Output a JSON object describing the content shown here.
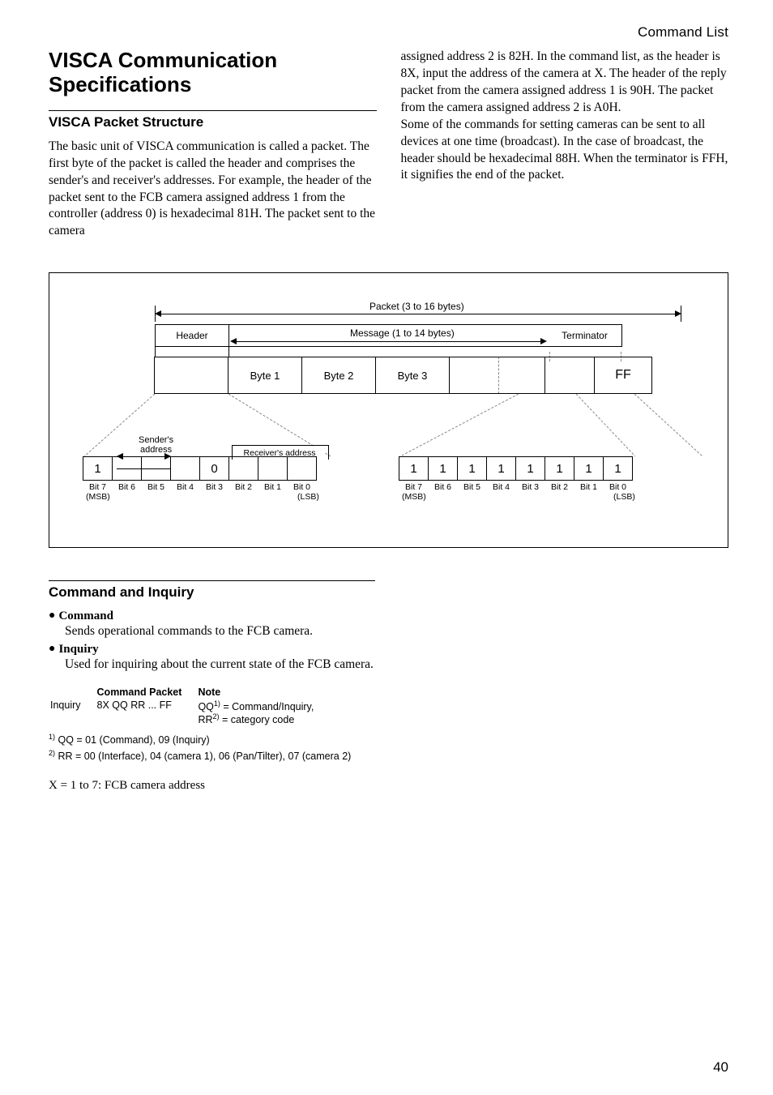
{
  "running_head": "Command List",
  "title": "VISCA Communication Specifications",
  "section1_heading": "VISCA Packet Structure",
  "left_para": "The basic unit of VISCA communication is called a packet. The first byte of the packet is called the header and comprises the sender's and receiver's addresses. For example, the header of the packet sent to the FCB camera assigned address 1 from the controller (address 0) is hexadecimal 81H. The packet sent to the camera",
  "right_para": "assigned address 2 is 82H. In the command list, as the header is 8X, input the address of the camera at X. The header of the reply packet from the camera assigned address 1 is 90H. The packet from the camera assigned address 2 is A0H.\nSome of the commands for setting cameras can be sent to all devices at one time (broadcast). In the case of broadcast, the header should be hexadecimal 88H. When the terminator is FFH, it signifies the end of the packet.",
  "diagram": {
    "packet_label": "Packet (3 to 16 bytes)",
    "header_label": "Header",
    "message_label": "Message (1 to 14 bytes)",
    "terminator_label": "Terminator",
    "byte1": "Byte 1",
    "byte2": "Byte 2",
    "byte3": "Byte 3",
    "ff": "FF",
    "senders_address": "Sender's\naddress",
    "receivers_address": "Receiver's address",
    "bit7": "Bit 7",
    "bit6": "Bit 6",
    "bit5": "Bit 5",
    "bit4": "Bit 4",
    "bit3": "Bit 3",
    "bit2": "Bit 2",
    "bit1": "Bit 1",
    "bit0": "Bit 0",
    "msb": "(MSB)",
    "lsb": "(LSB)",
    "one": "1",
    "zero": "0"
  },
  "section2_heading": "Command and Inquiry",
  "bullets": {
    "cmd_label": "Command",
    "cmd_desc": "Sends operational commands to the FCB camera.",
    "inq_label": "Inquiry",
    "inq_desc": "Used for inquiring about the current state of the FCB camera."
  },
  "table": {
    "h1": "Command Packet",
    "h2": "Note",
    "row_label": "Inquiry",
    "row_packet": "8X QQ RR ... FF",
    "row_note1": "QQ",
    "row_note1_sup": "1)",
    "row_note1_rest": " = Command/Inquiry,",
    "row_note2": "RR",
    "row_note2_sup": "2)",
    "row_note2_rest": " = category code"
  },
  "foot1_sup": "1)",
  "foot1": " QQ = 01 (Command), 09 (Inquiry)",
  "foot2_sup": "2)",
  "foot2": " RR = 00 (Interface), 04 (camera 1), 06 (Pan/Tilter), 07 (camera 2)",
  "x_note": "X = 1 to 7: FCB camera address",
  "page_num": "40"
}
